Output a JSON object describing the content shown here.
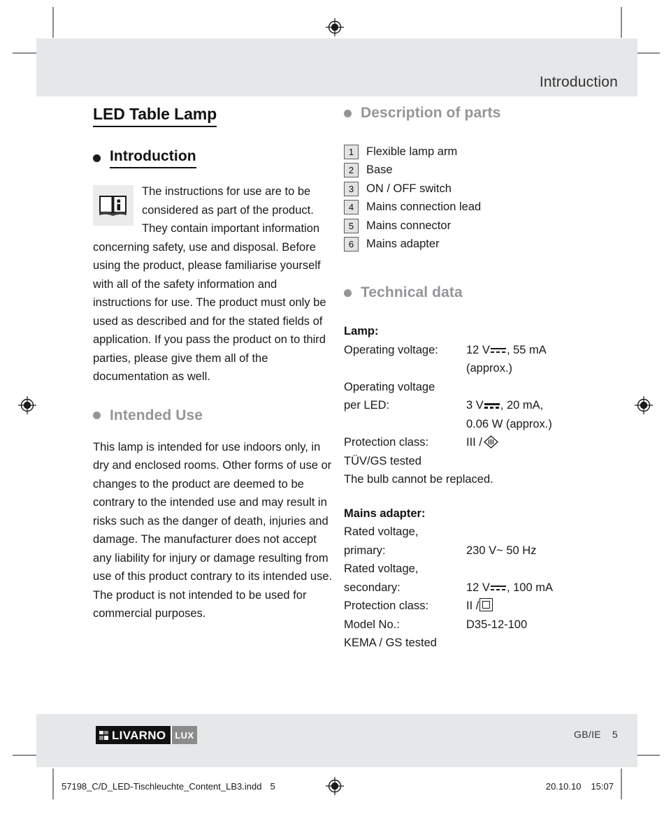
{
  "header": {
    "running_head": "Introduction"
  },
  "document": {
    "title": "LED Table Lamp"
  },
  "left_column": {
    "intro": {
      "heading": "Introduction",
      "icon": "info-book-icon",
      "paragraph": "The instructions for use are to be considered as part of the product. They contain important information concerning safety, use and disposal. Before using the product, please familiarise yourself with all of the safety information and instructions for use. The product must only be used as described and for the stated fields of application. If you pass the product on to third parties, please give them all of the documentation as well."
    },
    "intended_use": {
      "heading": "Intended Use",
      "paragraph": "This lamp is intended for use indoors only, in dry and enclosed rooms. Other forms of use or changes to the product are deemed to be contrary to the intended use and may result in risks such as the danger of death, injuries and damage. The manufacturer does not accept any liability for injury or damage resulting from use of this product contrary to its intended use. The product is not intended to be used for commercial purposes."
    }
  },
  "right_column": {
    "description_of_parts": {
      "heading": "Description of parts",
      "items": [
        {
          "num": "1",
          "label": "Flexible lamp arm"
        },
        {
          "num": "2",
          "label": "Base"
        },
        {
          "num": "3",
          "label": "ON / OFF switch"
        },
        {
          "num": "4",
          "label": "Mains connection lead"
        },
        {
          "num": "5",
          "label": "Mains connector"
        },
        {
          "num": "6",
          "label": "Mains adapter"
        }
      ]
    },
    "technical_data": {
      "heading": "Technical data",
      "lamp": {
        "group_title": "Lamp:",
        "operating_voltage_key": "Operating voltage:",
        "operating_voltage_val_pre": "12 V",
        "operating_voltage_val_post": ", 55 mA",
        "operating_voltage_val_line2": "(approx.)",
        "operating_voltage_led_key_line1": "Operating voltage",
        "operating_voltage_led_key_line2": "per LED:",
        "operating_voltage_led_val_pre": "3 V",
        "operating_voltage_led_val_post": ", 20 mA,",
        "operating_voltage_led_val_line2": "0.06 W (approx.)",
        "protection_class_key": "Protection class:",
        "protection_class_val": "III /",
        "tuv_gs": "TÜV/GS tested",
        "bulb_note": "The bulb cannot be replaced."
      },
      "mains_adapter": {
        "group_title": "Mains adapter:",
        "rated_voltage_primary_key_line1": "Rated voltage,",
        "rated_voltage_primary_key_line2": "primary:",
        "rated_voltage_primary_val": "230 V~ 50 Hz",
        "rated_voltage_secondary_key_line1": "Rated voltage,",
        "rated_voltage_secondary_key_line2": "secondary:",
        "rated_voltage_secondary_val_pre": "12 V",
        "rated_voltage_secondary_val_post": ", 100 mA",
        "protection_class_key": "Protection class:",
        "protection_class_val": "II /",
        "model_no_key": "Model No.:",
        "model_no_val": "D35-12-100",
        "kema_gs": "KEMA / GS tested"
      }
    }
  },
  "footer": {
    "brand_mark": "LIVARNO",
    "brand_sub": "LUX",
    "locale": "GB/IE",
    "page_number": "5"
  },
  "print_info": {
    "filename": "57198_C/D_LED-Tischleuchte_Content_LB3.indd",
    "page": "5",
    "date": "20.10.10",
    "time": "15:07"
  },
  "colors": {
    "band_grey": "#e6e7e9",
    "heading_grey": "#939598",
    "text_black": "#1a1a1a"
  }
}
